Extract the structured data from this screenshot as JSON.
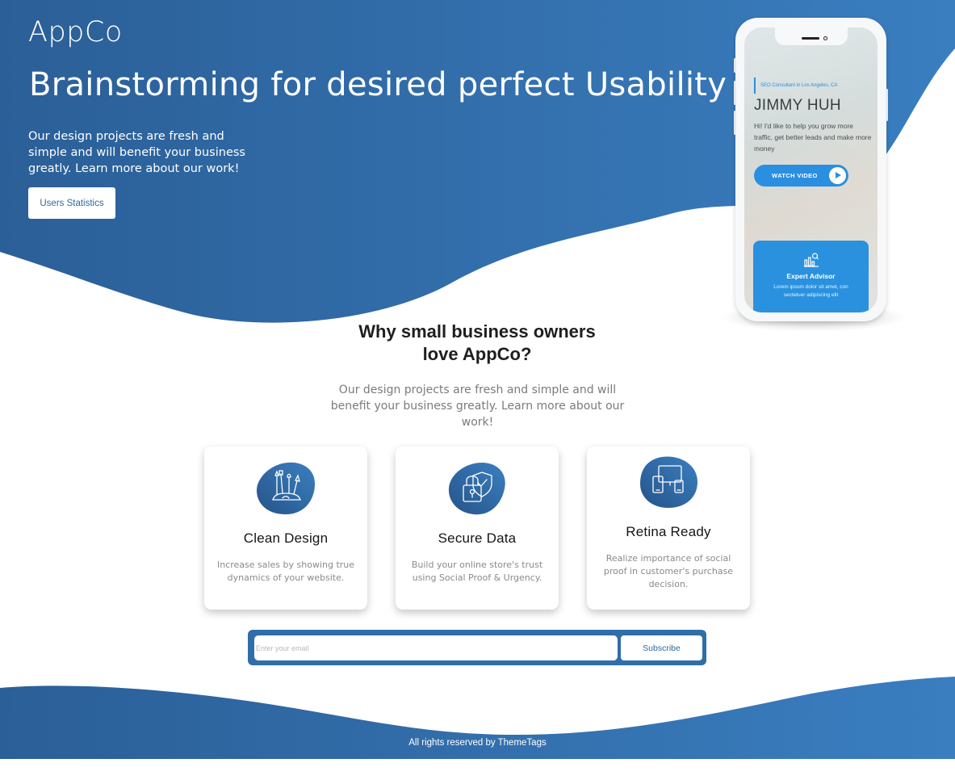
{
  "brand": "AppCo",
  "hero": {
    "title": "Brainstorming for desired perfect Usability",
    "text": "Our design projects are fresh and simple and will benefit your business greatly. Learn more about our work!",
    "button_label": "Users Statistics"
  },
  "phone": {
    "subtitle": "SEO Consultant in Los Angeles, CA",
    "name": "JIMMY HUH",
    "description": "Hi! I'd like to help you grow more traffic, get better leads and make more money",
    "video_label": "WATCH VIDEO",
    "card_title": "Expert Advisor",
    "card_text": "Lorem ipsum dolor sit amet, con sectetuer adipiscing elit"
  },
  "why": {
    "prefix": "Why ",
    "bold1": "small business owners",
    "bold2": "love",
    "suffix": " AppCo?",
    "text": "Our design projects are fresh and simple and will benefit your business greatly. Learn more about our work!"
  },
  "features": [
    {
      "title": "Clean Design",
      "desc": "Increase sales by showing true dynamics of your website.",
      "icon": "design-tools-icon"
    },
    {
      "title": "Secure Data",
      "desc": "Build your online store's trust using Social Proof & Urgency.",
      "icon": "shield-lock-icon"
    },
    {
      "title": "Retina Ready",
      "desc": "Realize importance of social proof in customer's purchase decision.",
      "icon": "devices-icon"
    }
  ],
  "subscribe": {
    "placeholder": "Enter your email",
    "button_label": "Subscribe"
  },
  "footer": {
    "copyright": "All rights reserved by ThemeTags"
  },
  "colors": {
    "primary": "#2f6ea8",
    "primary_dark": "#25548a",
    "accent": "#2a8fe0"
  }
}
